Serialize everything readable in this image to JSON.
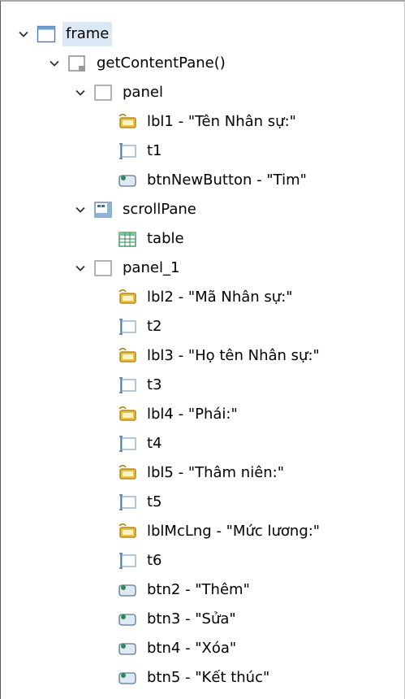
{
  "tree": {
    "nodes": [
      {
        "label": "frame",
        "icon": "frame-icon",
        "expandable": true,
        "selected": true
      },
      {
        "label": "getContentPane()",
        "icon": "content-pane-icon",
        "expandable": true
      },
      {
        "label": "panel",
        "icon": "panel-icon",
        "expandable": true
      },
      {
        "label": "lbl1 - \"Tên Nhân sự:\"",
        "icon": "label-icon"
      },
      {
        "label": "t1",
        "icon": "textfield-icon"
      },
      {
        "label": "btnNewButton - \"Tim\"",
        "icon": "button-icon"
      },
      {
        "label": "scrollPane",
        "icon": "scrollpane-icon",
        "expandable": true
      },
      {
        "label": "table",
        "icon": "table-icon"
      },
      {
        "label": "panel_1",
        "icon": "panel-icon",
        "expandable": true
      },
      {
        "label": "lbl2 - \"Mã Nhân sự:\"",
        "icon": "label-icon"
      },
      {
        "label": "t2",
        "icon": "textfield-icon"
      },
      {
        "label": "lbl3 - \"Họ tên Nhân sự:\"",
        "icon": "label-icon"
      },
      {
        "label": "t3",
        "icon": "textfield-icon"
      },
      {
        "label": "lbl4 - \"Phái:\"",
        "icon": "label-icon"
      },
      {
        "label": "t4",
        "icon": "textfield-icon"
      },
      {
        "label": "lbl5 - \"Thâm niên:\"",
        "icon": "label-icon"
      },
      {
        "label": "t5",
        "icon": "textfield-icon"
      },
      {
        "label": "lblMcLng - \"Mức lương:\"",
        "icon": "label-icon"
      },
      {
        "label": "t6",
        "icon": "textfield-icon"
      },
      {
        "label": "btn2 - \"Thêm\"",
        "icon": "button-icon"
      },
      {
        "label": "btn3 - \"Sửa\"",
        "icon": "button-icon"
      },
      {
        "label": "btn4 - \"Xóa\"",
        "icon": "button-icon"
      },
      {
        "label": "btn5 - \"Kết thúc\"",
        "icon": "button-icon"
      }
    ]
  },
  "colors": {
    "selection": "#dbe8f5",
    "frame_border": "#4a7bb0",
    "label_icon": "#d4a017",
    "button_icon": "#2e8b57"
  }
}
